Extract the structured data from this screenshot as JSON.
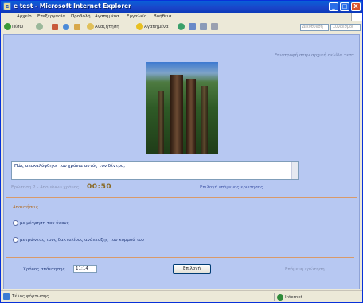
{
  "window": {
    "title": "e test - Microsoft Internet Explorer",
    "minimize_glyph": "_",
    "maximize_glyph": "□",
    "close_glyph": "X",
    "app_glyph": "e"
  },
  "menubar": {
    "items": [
      "Αρχείο",
      "Επεξεργασία",
      "Προβολή",
      "Αγαπημένα",
      "Εργαλεία",
      "Βοήθεια"
    ]
  },
  "toolbar": {
    "back_label": "Πίσω",
    "search_label": "Αναζήτηση",
    "favorites_label": "Αγαπημένα",
    "address_placeholder": "Διεύθυνση",
    "links_label": "Σύνδεσμοι"
  },
  "page": {
    "top_link": "Επιστροφή στην αρχική σελίδα τεστ",
    "question": "Πώς αποκαλύφθηκε του χρόνια αυτός τον δέντρο;",
    "timer_label": "Ερώτηση 2 - Απομένων χρόνος",
    "timer_value": "00:50",
    "other_link": "Επιλογή επόμενης ερώτησης",
    "answers_title": "Απαντήσεις",
    "answers": [
      "με μέτρηση του ύψους",
      "μετρώντας τους δακτυλίους ανάπτυξης του κορμού του"
    ],
    "submit_time_label": "Χρόνος απάντησης",
    "submit_time_value": "11:14",
    "check_button": "Επιλογή",
    "next_link": "Επόμενη ερώτηση"
  },
  "statusbar": {
    "text": "Τέλος φόρτωσης",
    "zone": "Internet"
  },
  "colors": {
    "content_bg": "#b7c8f2",
    "titlebar": "#0a5fd8",
    "timer": "#8a6a25",
    "divider": "#d89a6a"
  }
}
